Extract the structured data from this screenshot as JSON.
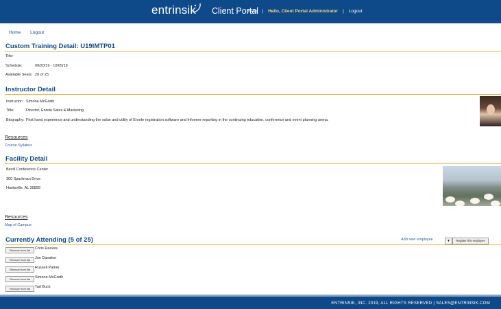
{
  "header": {
    "logo_text": "entrinsik",
    "portal_label": "Client Portal",
    "help": "Help",
    "hello": "Hello,",
    "user_name": "Client Portal Administrator",
    "logout": "Logout",
    "separator": "|"
  },
  "nav": {
    "home": "Home",
    "logout": "Logout"
  },
  "training": {
    "title": "Custom Training Detail: U19IMTP01",
    "title_label": "Title:",
    "title_value": "",
    "schedule_label": "Schedule:",
    "schedule_value": "09/20/19 - 10/05/19",
    "seats_label": "Available Seats:",
    "seats_value": "20 of 25"
  },
  "instructor": {
    "header": "Instructor Detail",
    "name_label": "Instructor:",
    "name_value": "Simone McGrath",
    "title_label": "Title:",
    "title_value": "Director, Enrole Sales & Marketing",
    "bio_label": "Biography:",
    "bio_value": "First hand experience and understanding the value and utility of Enrole registration software and Informer reporting in the continuing education, conference and event planning arena."
  },
  "resources1": {
    "title": "Resources",
    "link": "Course Syllabus"
  },
  "facility": {
    "header": "Facility Detail",
    "line1": "Bevill Conference Center",
    "line2": "300 Sparkman Drive",
    "line3": "Huntsville, AL 35899"
  },
  "resources2": {
    "title": "Resources",
    "link": "Map of Campus"
  },
  "attending": {
    "header": "Currently Attending (5 of 25)",
    "add_link": "Add new employee",
    "dropdown_arrow": "▼",
    "register_button": "Register this employee",
    "remove_label": "Remove from list",
    "attendees": [
      "Chris Reaves",
      "Jon Danaher",
      "Russell Parker",
      "Simone McGrath",
      "Tad Buck"
    ]
  },
  "footer": {
    "text": "ENTRINSIK, INC. 2019, ALL RIGHTS RESERVED  |  SALES@ENTRINSIK.COM"
  },
  "colors": {
    "brand_blue": "#0e4a8a",
    "accent_gold": "#f1b33b",
    "link_blue": "#1f5fa8"
  }
}
